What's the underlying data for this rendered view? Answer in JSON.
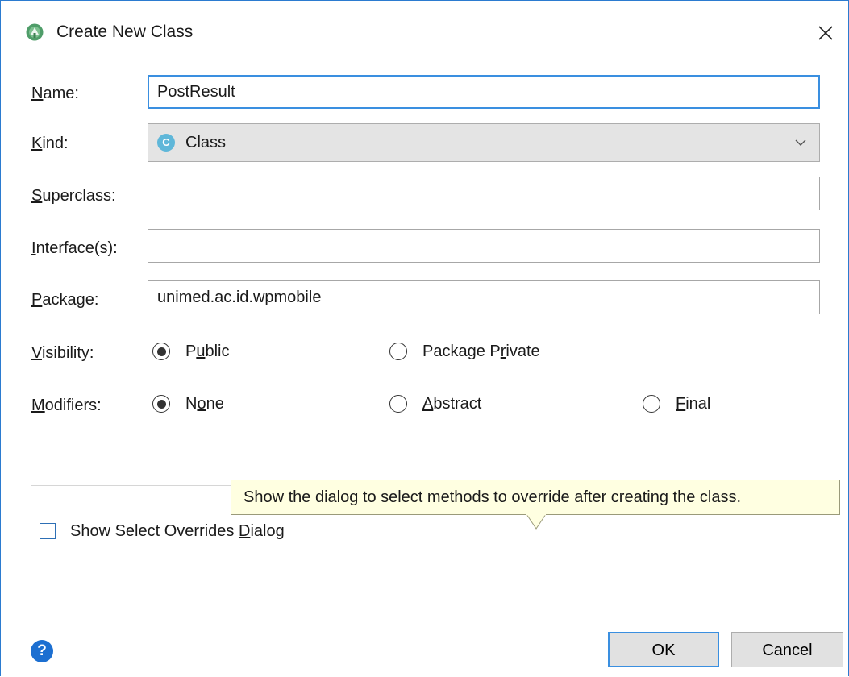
{
  "window": {
    "title": "Create New Class",
    "app_icon": "android-studio-icon",
    "close_icon": "close-icon"
  },
  "form": {
    "name": {
      "label_mn": "N",
      "label_rest": "ame:",
      "value": "PostResult"
    },
    "kind": {
      "label_mn": "K",
      "label_rest": "ind:",
      "value": "Class",
      "icon_letter": "C"
    },
    "superclass": {
      "label_mn": "S",
      "label_rest": "uperclass:",
      "value": ""
    },
    "interfaces": {
      "label_mn": "I",
      "label_rest": "nterface(s):",
      "value": ""
    },
    "package": {
      "label_mn": "P",
      "label_rest": "ackage:",
      "value": "unimed.ac.id.wpmobile"
    },
    "visibility": {
      "label_mn": "V",
      "label_rest": "isibility:",
      "options": [
        {
          "pre": "P",
          "mn": "u",
          "post": "blic",
          "selected": true
        },
        {
          "pre": "Package P",
          "mn": "r",
          "post": "ivate",
          "selected": false
        }
      ]
    },
    "modifiers": {
      "label_mn": "M",
      "label_rest": "odifiers:",
      "options": [
        {
          "pre": "N",
          "mn": "o",
          "post": "ne",
          "selected": true
        },
        {
          "pre": "",
          "mn": "A",
          "post": "bstract",
          "selected": false
        },
        {
          "pre": "",
          "mn": "F",
          "post": "inal",
          "selected": false
        }
      ]
    }
  },
  "overrides_checkbox": {
    "pre": "Show Select Overrides ",
    "mn": "D",
    "post": "ialog",
    "checked": false
  },
  "tooltip": {
    "text": "Show the dialog to select methods to override after creating the class."
  },
  "footer": {
    "help_symbol": "?",
    "ok_label": "OK",
    "cancel_label": "Cancel"
  },
  "colors": {
    "accent": "#3a8fe0",
    "tooltip_bg": "#ffffe1",
    "help_blue": "#1c6fd1"
  }
}
